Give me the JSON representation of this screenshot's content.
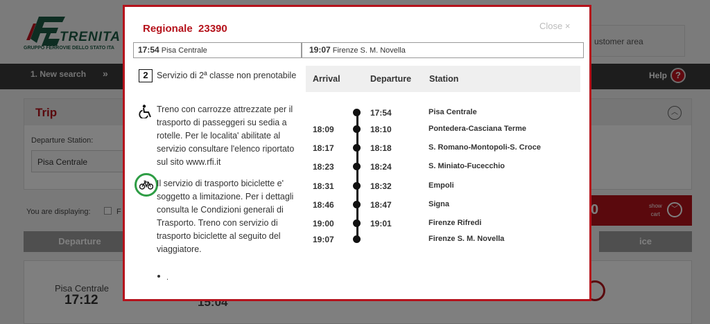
{
  "background": {
    "logo_text": "TRENITA",
    "logo_sub": "GRUPPO FERROVIE DELLO STATO ITA",
    "customer_area": "ustomer area",
    "nav_step": "1. New search",
    "nav_arrow": "»",
    "help": "Help",
    "help_icon": "?",
    "trip_title": "Trip",
    "departure_station_label": "Departure Station:",
    "departure_station_value": "Pisa Centrale",
    "displaying_label": "You are displaying:",
    "displaying_f": "F",
    "cart_amount": "0",
    "cart_show": "show",
    "cart_cart": "cart",
    "col_departure": "Departure",
    "col_ice": "ice",
    "result_station": "Pisa Centrale",
    "result_time": "17:12",
    "result_time2": "15:04",
    "colors": {
      "accent": "#b5121b",
      "highlight_ring": "#2e9d45"
    }
  },
  "modal": {
    "title": "Regionale  23390",
    "close": "Close ×",
    "from_time": "17:54",
    "from_station": "Pisa Centrale",
    "to_time": "19:07",
    "to_station": "Firenze S. M. Novella",
    "services": [
      {
        "icon": "second-class-icon",
        "icon_text": "2",
        "text": "Servizio di 2ª classe non prenotabile"
      },
      {
        "icon": "wheelchair-icon",
        "text": "Treno con carrozze attrezzate per il trasporto di passeggeri su sedia a rotelle. Per le localita' abilitate al servizio consultare l'elenco riportato sul sito www.rfi.it"
      },
      {
        "icon": "bicycle-icon",
        "text": "Il servizio di trasporto biciclette e' soggetto a limitazione. Per i dettagli consulta le Condizioni generali di Trasporto. Treno con servizio di trasporto biciclette al seguito del viaggiatore."
      }
    ],
    "bullet_text": ".",
    "timetable": {
      "headers": {
        "arrival": "Arrival",
        "departure": "Departure",
        "station": "Station"
      },
      "rows": [
        {
          "arrival": "",
          "departure": "17:54",
          "station": "Pisa Centrale"
        },
        {
          "arrival": "18:09",
          "departure": "18:10",
          "station": "Pontedera-Casciana Terme"
        },
        {
          "arrival": "18:17",
          "departure": "18:18",
          "station": "S. Romano-Montopoli-S. Croce"
        },
        {
          "arrival": "18:23",
          "departure": "18:24",
          "station": "S. Miniato-Fucecchio"
        },
        {
          "arrival": "18:31",
          "departure": "18:32",
          "station": "Empoli"
        },
        {
          "arrival": "18:46",
          "departure": "18:47",
          "station": "Signa"
        },
        {
          "arrival": "19:00",
          "departure": "19:01",
          "station": "Firenze Rifredi"
        },
        {
          "arrival": "19:07",
          "departure": "",
          "station": "Firenze S. M. Novella"
        }
      ]
    }
  }
}
